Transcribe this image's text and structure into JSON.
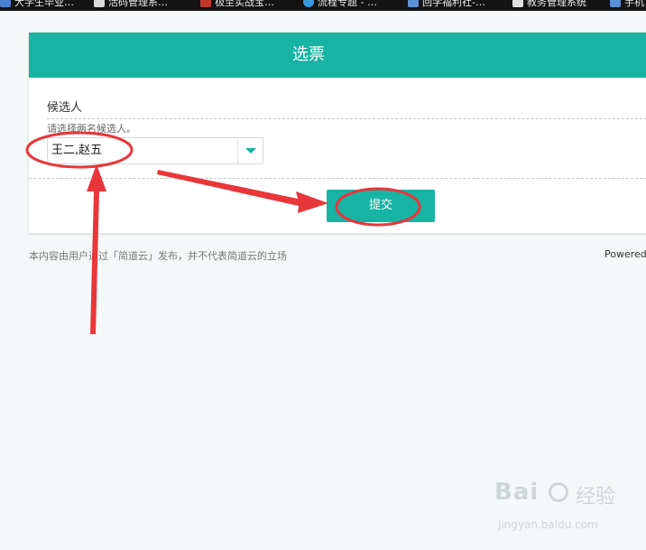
{
  "bookmarks": [
    {
      "label": "大学生毕业…",
      "icon": "page-icon",
      "color": "#4a7fd0"
    },
    {
      "label": "活码管理系…",
      "icon": "app-icon",
      "color": "#d9d9d9"
    },
    {
      "label": "极至实战宝…",
      "icon": "bird-icon",
      "color": "#c0392b"
    },
    {
      "label": "流程专题 - …",
      "icon": "globe-icon",
      "color": "#3a9bd9"
    },
    {
      "label": "回学福利社-…",
      "icon": "home-icon",
      "color": "#5b8fd6"
    },
    {
      "label": "教务管理系统",
      "icon": "doc-icon",
      "color": "#e0e0e0"
    },
    {
      "label": "手机",
      "icon": "home-icon",
      "color": "#5b8fd6"
    }
  ],
  "form": {
    "title": "选票",
    "field_label": "候选人",
    "field_desc": "请选择两名候选人。",
    "selected_value": "王二,赵五",
    "submit_label": "提交"
  },
  "footer": {
    "disclaimer": "本内容由用户通过「简道云」发布，并不代表简道云的立场",
    "powered": "Powered"
  },
  "watermark": {
    "brand": "Bai",
    "brand_cn": "经验",
    "url": "jingyan.baidu.com"
  },
  "colors": {
    "accent": "#17b3a3",
    "annotation": "#e8363a"
  }
}
